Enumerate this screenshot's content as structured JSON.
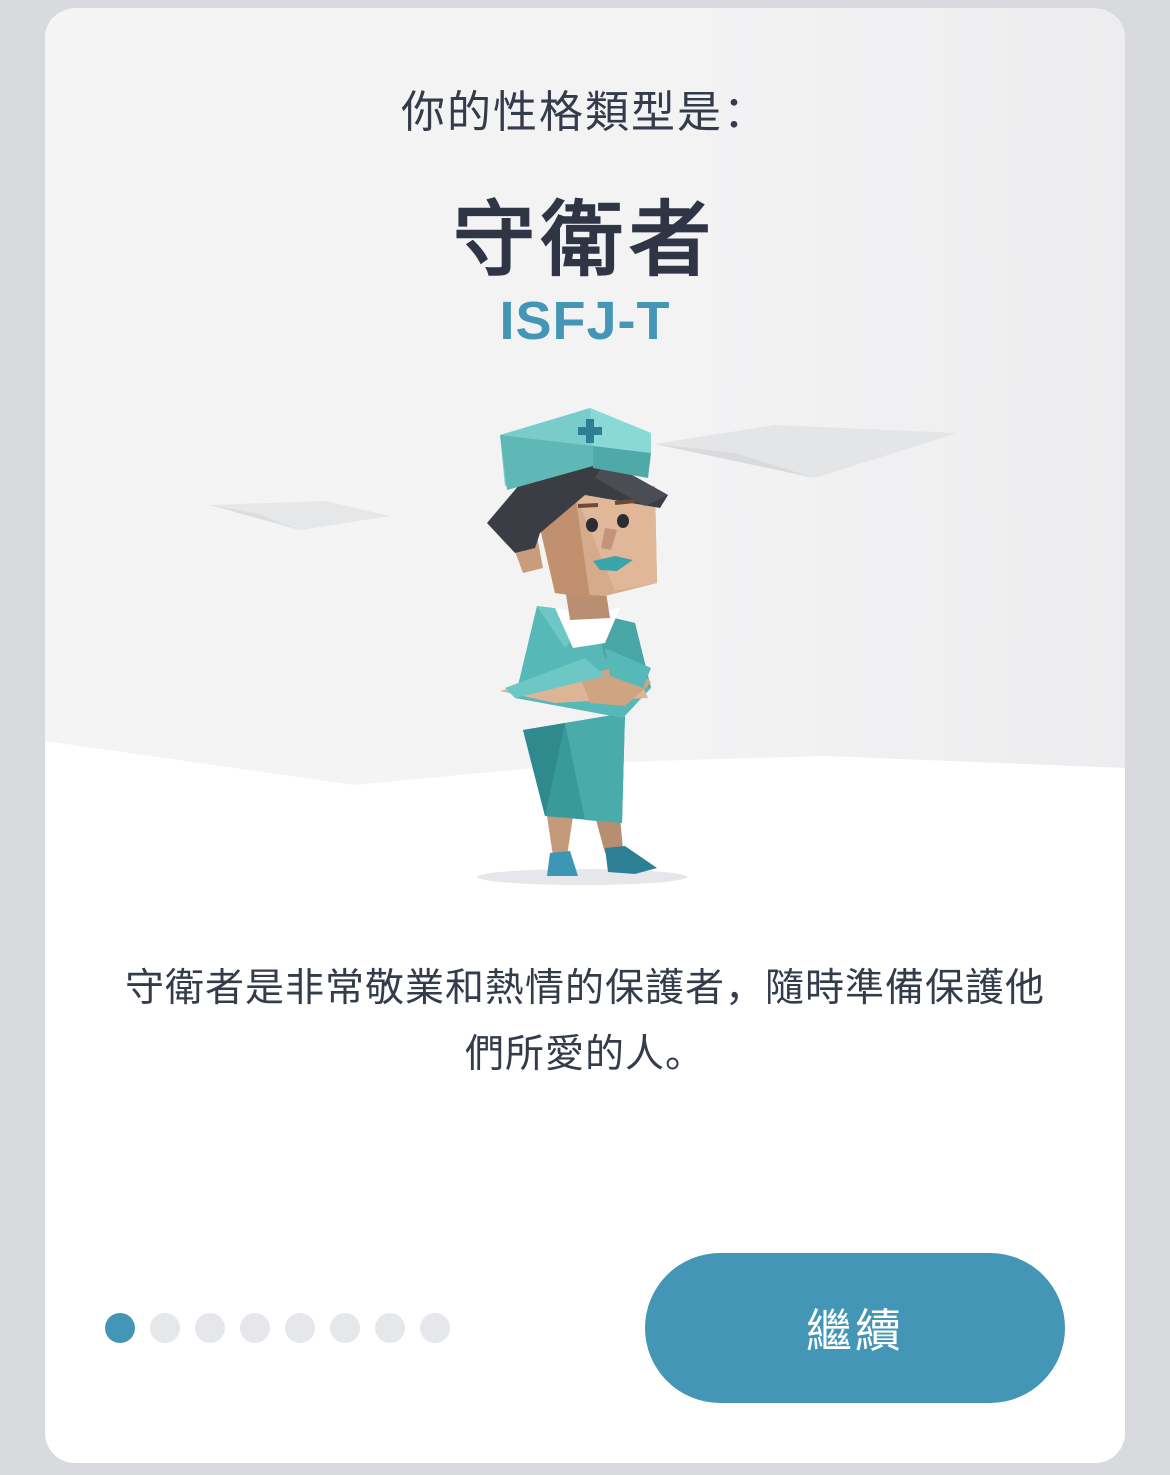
{
  "result": {
    "prompt": "你的性格類型是：",
    "type_name": "守衛者",
    "type_code": "ISFJ-T",
    "description": "守衛者是非常敬業和熱情的保護者，隨時準備保護他們所愛的人。"
  },
  "pagination": {
    "total": 8,
    "current": 1
  },
  "actions": {
    "continue_label": "繼續"
  },
  "colors": {
    "accent": "#4396b6",
    "text_dark": "#2f3545",
    "inactive_dot": "#e6e7ea"
  },
  "illustration": {
    "icon": "nurse-character-illustration"
  }
}
